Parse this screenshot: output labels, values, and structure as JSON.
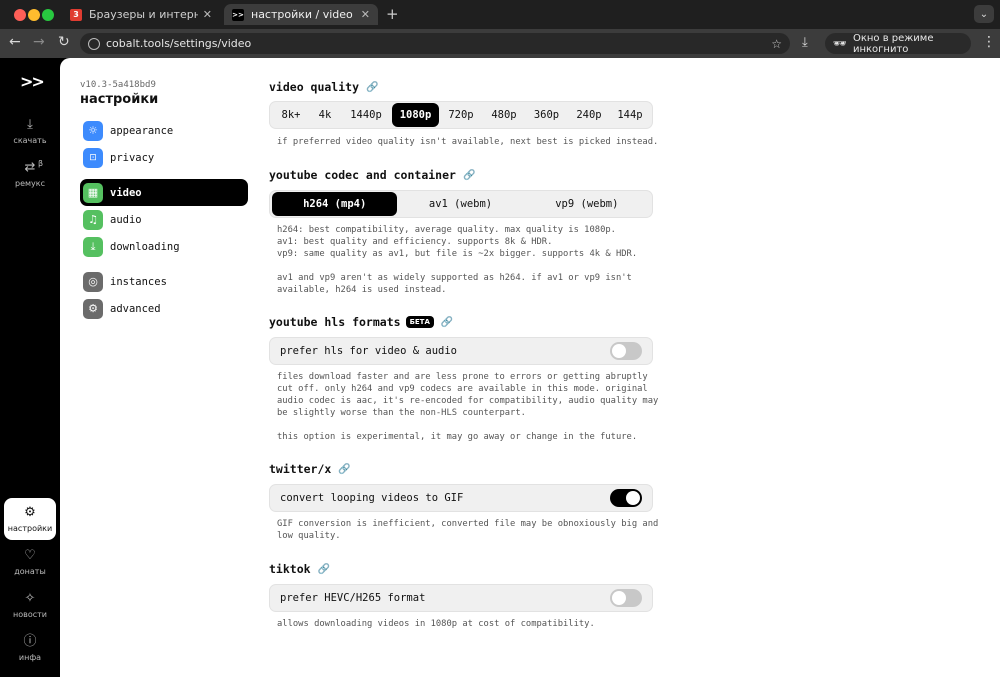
{
  "browser": {
    "tabs": [
      {
        "title": "Браузеры и интернет. Скач",
        "favicon": "3",
        "active": false
      },
      {
        "title": "настройки / video ~ кобальт",
        "favicon": ">>",
        "active": true
      }
    ],
    "url": "cobalt.tools/settings/video",
    "incognito_label": "Окно в режиме инкогнито",
    "icons": {
      "back": "arrow-left-icon",
      "forward": "arrow-right-icon",
      "reload": "reload-icon",
      "bookmark": "star-icon",
      "download": "download-icon",
      "menu": "kebab-icon"
    }
  },
  "rail": {
    "logo": ">>",
    "items": [
      {
        "label": "скачать",
        "icon": "download-icon",
        "glyph": "⤓"
      },
      {
        "label": "ремукс",
        "icon": "remux-icon",
        "glyph": "⇄",
        "badge": "β"
      },
      {
        "label": "настройки",
        "icon": "gear-icon",
        "glyph": "⚙"
      },
      {
        "label": "донаты",
        "icon": "heart-icon",
        "glyph": "♡"
      },
      {
        "label": "новости",
        "icon": "sparkle-icon",
        "glyph": "✧"
      },
      {
        "label": "инфа",
        "icon": "info-icon",
        "glyph": "ⓘ"
      }
    ]
  },
  "settings": {
    "version": "v10.3-5a418bd9",
    "title": "настройки",
    "nav": [
      {
        "label": "appearance",
        "icon": "sun-icon",
        "glyph": "☼",
        "color": "#3d8bfd"
      },
      {
        "label": "privacy",
        "icon": "lock-icon",
        "glyph": "🔒",
        "color": "#3d8bfd"
      },
      {
        "label": "video",
        "icon": "film-icon",
        "glyph": "▦",
        "color": "#55c060"
      },
      {
        "label": "audio",
        "icon": "music-icon",
        "glyph": "♫",
        "color": "#55c060"
      },
      {
        "label": "downloading",
        "icon": "file-download-icon",
        "glyph": "⤓",
        "color": "#55c060"
      },
      {
        "label": "instances",
        "icon": "globe-icon",
        "glyph": "◎",
        "color": "#6b6b6b"
      },
      {
        "label": "advanced",
        "icon": "gear-advanced-icon",
        "glyph": "⚙",
        "color": "#6b6b6b"
      }
    ]
  },
  "video_quality": {
    "title": "video quality",
    "options": [
      "8k+",
      "4k",
      "1440p",
      "1080p",
      "720p",
      "480p",
      "360p",
      "240p",
      "144p"
    ],
    "selected": "1080p",
    "description": "if preferred video quality isn't available, next best is picked instead."
  },
  "youtube_codec": {
    "title": "youtube codec and container",
    "options": [
      "h264 (mp4)",
      "av1 (webm)",
      "vp9 (webm)"
    ],
    "selected": "h264 (mp4)",
    "description": "h264: best compatibility, average quality. max quality is 1080p.\nav1: best quality and efficiency. supports 8k & HDR.\nvp9: same quality as av1, but file is ~2x bigger. supports 4k & HDR.\n\nav1 and vp9 aren't as widely supported as h264. if av1 or vp9 isn't\navailable, h264 is used instead."
  },
  "youtube_hls": {
    "title": "youtube hls formats",
    "badge": "БЕТА",
    "toggle_label": "prefer hls for video & audio",
    "enabled": false,
    "description": "files download faster and are less prone to errors or getting abruptly\ncut off. only h264 and vp9 codecs are available in this mode. original\naudio codec is aac, it's re-encoded for compatibility, audio quality may\nbe slightly worse than the non-HLS counterpart.\n\nthis option is experimental, it may go away or change in the future."
  },
  "twitter": {
    "title": "twitter/x",
    "toggle_label": "convert looping videos to GIF",
    "enabled": true,
    "description": "GIF conversion is inefficient, converted file may be obnoxiously big and\nlow quality."
  },
  "tiktok": {
    "title": "tiktok",
    "toggle_label": "prefer HEVC/H265 format",
    "enabled": false,
    "description": "allows downloading videos in 1080p at cost of compatibility."
  }
}
